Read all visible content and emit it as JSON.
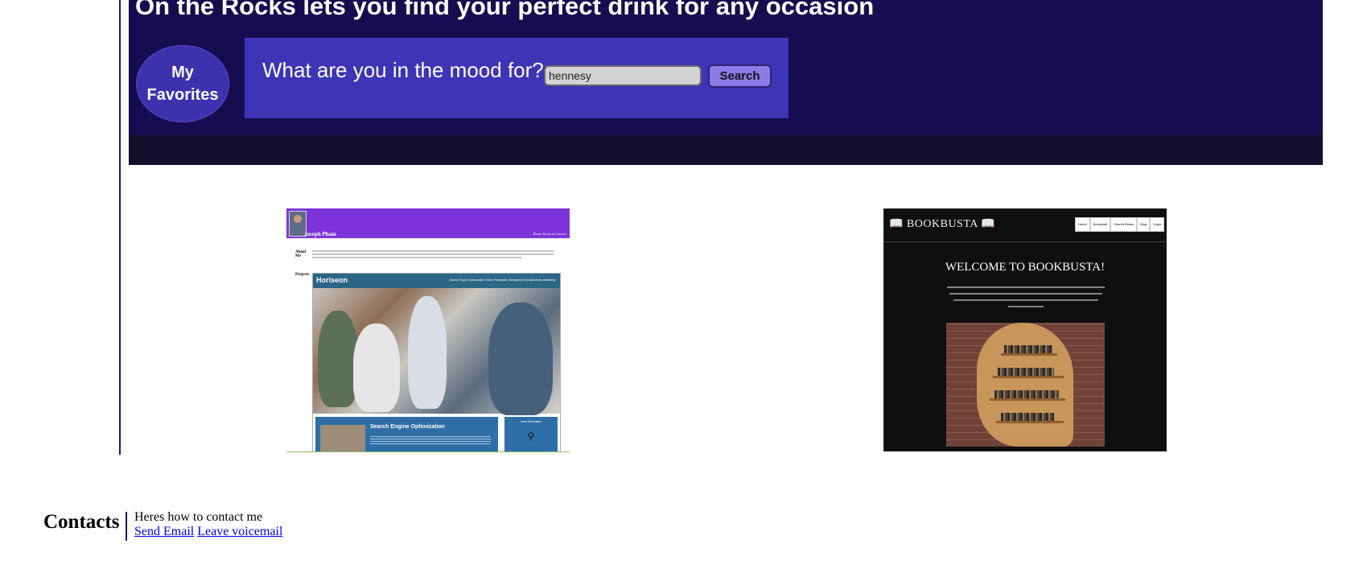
{
  "banner": {
    "title": "On the Rocks lets you find your perfect drink for any occasion",
    "favorites_label": "My Favorites",
    "mood_label": "What are you in the mood for?",
    "search_value": "hennesy",
    "search_button": "Search",
    "colors": {
      "background": "#150d4f",
      "panel": "#3d34b6",
      "button": "#8d79e8"
    }
  },
  "projects": [
    {
      "owner_name": "Joseph Pham",
      "nav": "Home   Projects   Contact",
      "about_label": "About Me",
      "projects_label": "Projects",
      "inner_site": {
        "logo": "Horiseon",
        "nav": "Search Engine Optimization     Online Reputation Management     Social Media Marketing",
        "card_title": "Search Engine Optimization",
        "side_title": "Lead Generation"
      }
    },
    {
      "logo": "📖 BOOKBUSTA 📖",
      "nav": [
        "Home",
        "Bookshelf",
        "Search Books",
        "Blog",
        "Login"
      ],
      "welcome": "WELCOME TO BOOKBUSTA!"
    }
  ],
  "contacts": {
    "title": "Contacts",
    "text": "Heres how to contact me",
    "email_link": "Send Email",
    "voicemail_link": "Leave voicemail"
  }
}
